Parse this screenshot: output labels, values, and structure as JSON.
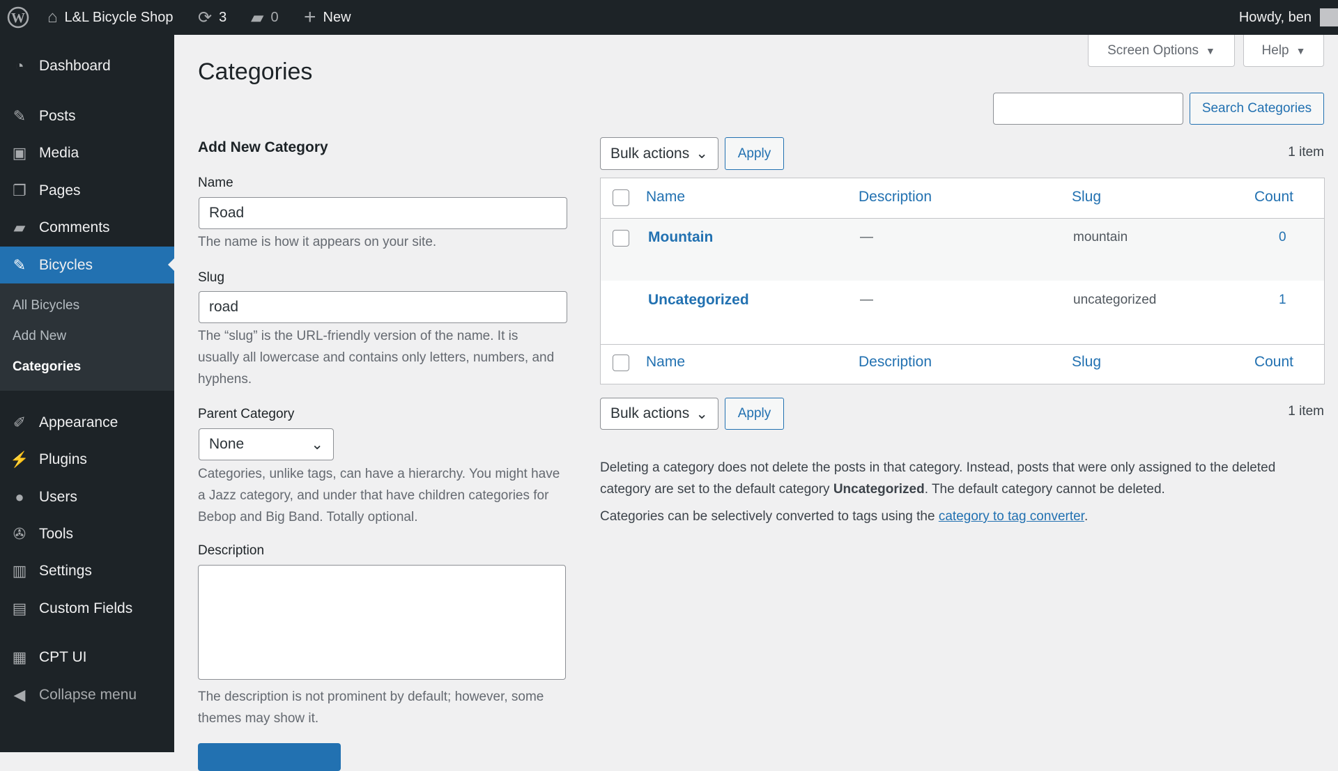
{
  "adminbar": {
    "site": "L&L Bicycle Shop",
    "updates": "3",
    "comments": "0",
    "new": "New",
    "howdy": "Howdy, ben"
  },
  "sidebar": {
    "items": [
      {
        "label": "Dashboard",
        "icon": "dashboard-icon"
      },
      {
        "label": "Posts",
        "icon": "pin-icon"
      },
      {
        "label": "Media",
        "icon": "media-icon"
      },
      {
        "label": "Pages",
        "icon": "pages-icon"
      },
      {
        "label": "Comments",
        "icon": "comment-icon"
      },
      {
        "label": "Bicycles",
        "icon": "pin-icon"
      },
      {
        "label": "Appearance",
        "icon": "brush-icon"
      },
      {
        "label": "Plugins",
        "icon": "plug-icon"
      },
      {
        "label": "Users",
        "icon": "user-icon"
      },
      {
        "label": "Tools",
        "icon": "wrench-icon"
      },
      {
        "label": "Settings",
        "icon": "settings-icon"
      },
      {
        "label": "Custom Fields",
        "icon": "table-icon"
      },
      {
        "label": "CPT UI",
        "icon": "grid-icon"
      }
    ],
    "submenu": [
      "All Bicycles",
      "Add New",
      "Categories"
    ],
    "collapse": "Collapse menu"
  },
  "header": {
    "title": "Categories",
    "screen_options": "Screen Options",
    "help": "Help"
  },
  "search": {
    "value": "",
    "button": "Search Categories"
  },
  "form": {
    "heading": "Add New Category",
    "name_label": "Name",
    "name_value": "Road",
    "name_help": "The name is how it appears on your site.",
    "slug_label": "Slug",
    "slug_value": "road",
    "slug_help": "The “slug” is the URL-friendly version of the name. It is usually all lowercase and contains only letters, numbers, and hyphens.",
    "parent_label": "Parent Category",
    "parent_value": "None",
    "parent_help": "Categories, unlike tags, can have a hierarchy. You might have a Jazz category, and under that have children categories for Bebop and Big Band. Totally optional.",
    "desc_label": "Description",
    "desc_value": "",
    "desc_help": "The description is not prominent by default; however, some themes may show it."
  },
  "table": {
    "bulk": "Bulk actions",
    "apply": "Apply",
    "count_text": "1 item",
    "columns": [
      "Name",
      "Description",
      "Slug",
      "Count"
    ],
    "rows": [
      {
        "name": "Mountain",
        "description": "—",
        "slug": "mountain",
        "count": "0"
      },
      {
        "name": "Uncategorized",
        "description": "—",
        "slug": "uncategorized",
        "count": "1"
      }
    ]
  },
  "notes": {
    "p1a": "Deleting a category does not delete the posts in that category. Instead, posts that were only assigned to the deleted category are set to the default category ",
    "p1b": "Uncategorized",
    "p1c": ". The default category cannot be deleted.",
    "p2a": "Categories can be selectively converted to tags using the ",
    "p2link": "category to tag converter",
    "p2b": "."
  },
  "colors": {
    "accent": "#2271b1",
    "adminbar": "#1d2327"
  }
}
